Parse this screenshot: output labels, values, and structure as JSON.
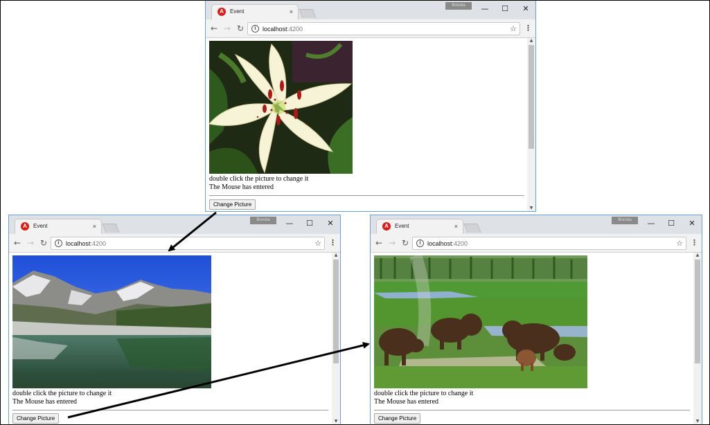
{
  "windows": [
    {
      "tab_title": "Event",
      "tab_icon": "angular-icon",
      "user_badge": "Brenda",
      "url_host": "localhost",
      "url_port": ":4200",
      "caption": "double click the picture to change it",
      "status": "The Mouse has entered",
      "button_label": "Change Picture",
      "picture": "lily-flower-photo"
    },
    {
      "tab_title": "Event",
      "tab_icon": "angular-icon",
      "user_badge": "Brenda",
      "url_host": "localhost",
      "url_port": ":4200",
      "caption": "double click the picture to change it",
      "status": "The Mouse has entered",
      "button_label": "Change Picture",
      "picture": "mountain-lake-photo"
    },
    {
      "tab_title": "Event",
      "tab_icon": "angular-icon",
      "user_badge": "Brenda",
      "url_host": "localhost",
      "url_port": ":4200",
      "caption": "double click the picture to change it",
      "status": "The Mouse has entered",
      "button_label": "Change Picture",
      "picture": "bison-herd-photo"
    }
  ],
  "colors": {
    "window_border": "#6aa0cf",
    "titlebar": "#dee1e6",
    "toolbar": "#f2f2f2",
    "angular_red": "#dd1b16",
    "arrow": "#000000"
  }
}
